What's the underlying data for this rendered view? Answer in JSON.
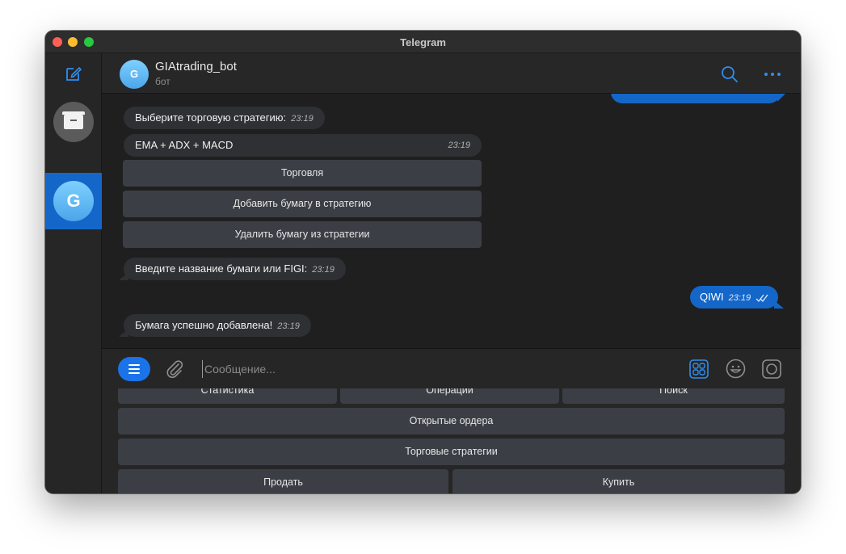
{
  "window": {
    "title": "Telegram"
  },
  "sidebar": {
    "avatar_letter": "G"
  },
  "header": {
    "avatar_letter": "G",
    "name": "GIAtrading_bot",
    "status": "бот"
  },
  "messages": {
    "top_outgoing_partial": "",
    "m1": {
      "text": "Выберите торговую стратегию:",
      "time": "23:19"
    },
    "m2": {
      "text": "EMA + ADX + MACD",
      "time": "23:19"
    },
    "inline_buttons": [
      "Торговля",
      "Добавить бумагу в стратегию",
      "Удалить бумагу из стратегии"
    ],
    "m3": {
      "text": "Введите название бумаги или FIGI:",
      "time": "23:19"
    },
    "m4": {
      "text": "QIWI",
      "time": "23:19",
      "outgoing": true
    },
    "m5": {
      "text": "Бумага успешно добавлена!",
      "time": "23:19"
    }
  },
  "composer": {
    "placeholder": "Сообщение..."
  },
  "keyboard": {
    "row1": [
      "Статистика",
      "Операции",
      "Поиск"
    ],
    "row2": [
      "Открытые ордера"
    ],
    "row3": [
      "Торговые стратегии"
    ],
    "row4": [
      "Продать",
      "Купить"
    ]
  },
  "colors": {
    "accent": "#1466c8",
    "bubble_in": "#2e3033",
    "button": "#3b3f45"
  }
}
